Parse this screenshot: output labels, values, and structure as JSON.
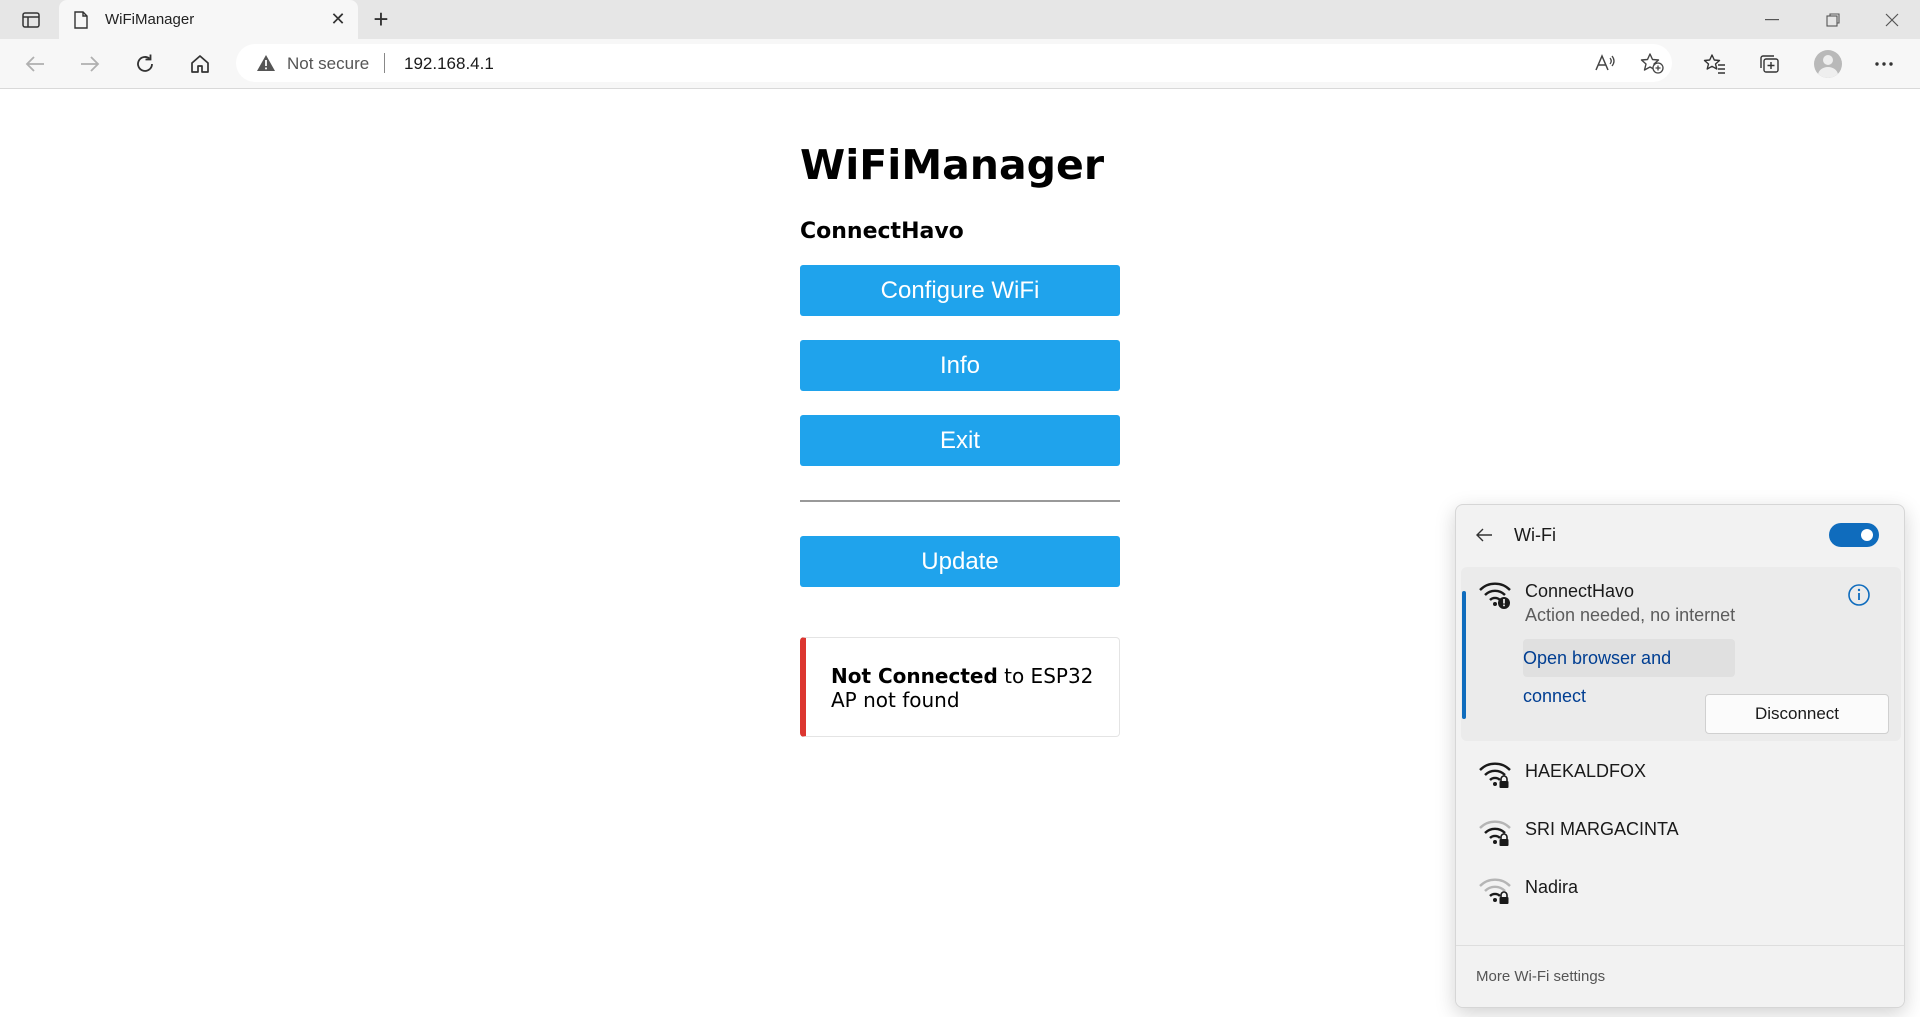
{
  "browser": {
    "tab": {
      "title": "WiFiManager"
    },
    "address": {
      "security_label": "Not secure",
      "url": "192.168.4.1"
    }
  },
  "page": {
    "title": "WiFiManager",
    "device_name": "ConnectHavo",
    "buttons": {
      "configure": "Configure WiFi",
      "info": "Info",
      "exit": "Exit",
      "update": "Update"
    },
    "status": {
      "bold": "Not Connected",
      "rest": " to ESP32",
      "detail": "AP not found"
    },
    "colors": {
      "button": "#1fa3ec",
      "status_border": "#dc3630"
    }
  },
  "wifi_flyout": {
    "title": "Wi-Fi",
    "enabled": true,
    "connected": {
      "name": "ConnectHavo",
      "status": "Action needed, no internet",
      "open_link": "Open browser and connect",
      "disconnect": "Disconnect"
    },
    "networks": [
      {
        "name": "HAEKALDFOX"
      },
      {
        "name": "SRI MARGACINTA"
      },
      {
        "name": "Nadira"
      }
    ],
    "footer": "More Wi-Fi settings",
    "accent": "#0f6cbd"
  }
}
